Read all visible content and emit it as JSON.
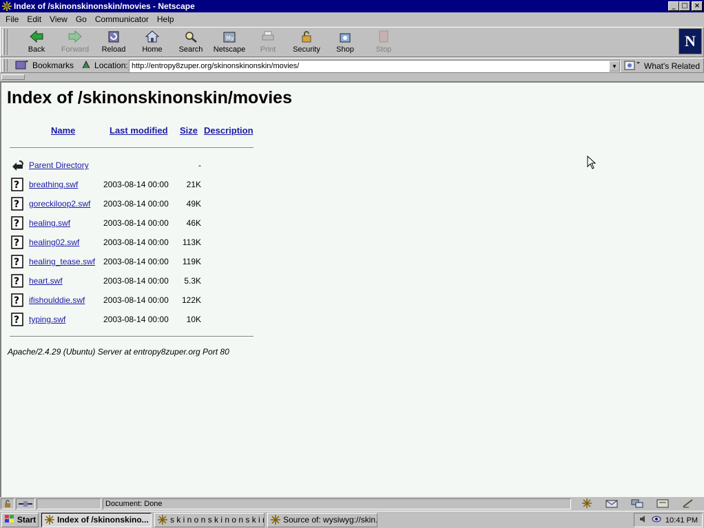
{
  "window": {
    "title": "Index of /skinonskinonskin/movies - Netscape",
    "controls": [
      "_",
      "□",
      "×"
    ]
  },
  "menubar": {
    "items": [
      {
        "label": "File"
      },
      {
        "label": "Edit"
      },
      {
        "label": "View"
      },
      {
        "label": "Go"
      },
      {
        "label": "Communicator"
      },
      {
        "label": "Help"
      }
    ]
  },
  "toolbar": {
    "buttons": [
      {
        "label": "Back",
        "icon": "back-arrow-icon",
        "enabled": true
      },
      {
        "label": "Forward",
        "icon": "forward-arrow-icon",
        "enabled": false
      },
      {
        "label": "Reload",
        "icon": "reload-icon",
        "enabled": true
      },
      {
        "label": "Home",
        "icon": "home-icon",
        "enabled": true
      },
      {
        "label": "Search",
        "icon": "search-icon",
        "enabled": true
      },
      {
        "label": "Netscape",
        "icon": "netscape-icon",
        "enabled": true
      },
      {
        "label": "Print",
        "icon": "printer-icon",
        "enabled": false
      },
      {
        "label": "Security",
        "icon": "lock-icon",
        "enabled": true
      },
      {
        "label": "Shop",
        "icon": "shop-icon",
        "enabled": true
      },
      {
        "label": "Stop",
        "icon": "stop-icon",
        "enabled": false
      }
    ],
    "logo_letter": "N"
  },
  "location_bar": {
    "bookmarks_label": "Bookmarks",
    "location_label": "Location:",
    "url": "http://entropy8zuper.org/skinonskinonskin/movies/",
    "whats_related_label": "What's Related"
  },
  "page": {
    "title": "Index of /skinonskinonskin/movies",
    "columns": {
      "name": "Name",
      "last_modified": "Last modified",
      "size": "Size",
      "description": "Description"
    },
    "parent": {
      "label": "Parent Directory",
      "size": "-"
    },
    "files": [
      {
        "name": "breathing.swf",
        "modified": "2003-08-14 00:00",
        "size": "21K"
      },
      {
        "name": "goreckiloop2.swf",
        "modified": "2003-08-14 00:00",
        "size": "49K"
      },
      {
        "name": "healing.swf",
        "modified": "2003-08-14 00:00",
        "size": "46K"
      },
      {
        "name": "healing02.swf",
        "modified": "2003-08-14 00:00",
        "size": "113K"
      },
      {
        "name": "healing_tease.swf",
        "modified": "2003-08-14 00:00",
        "size": "119K"
      },
      {
        "name": "heart.swf",
        "modified": "2003-08-14 00:00",
        "size": "5.3K"
      },
      {
        "name": "ifishoulddie.swf",
        "modified": "2003-08-14 00:00",
        "size": "122K"
      },
      {
        "name": "typing.swf",
        "modified": "2003-08-14 00:00",
        "size": "10K"
      }
    ],
    "server_signature": "Apache/2.4.29 (Ubuntu) Server at entropy8zuper.org Port 80"
  },
  "statusbar": {
    "text": "Document: Done"
  },
  "taskbar": {
    "start_label": "Start",
    "tasks": [
      {
        "label": "Index of /skinonskino...",
        "active": true
      },
      {
        "label": "s k i n o n s k i n o n s k i n...",
        "active": false
      },
      {
        "label": "Source of: wysiwyg://skin...",
        "active": false
      }
    ],
    "clock": "10:41 PM"
  },
  "colors": {
    "titlebar": "#000080",
    "link": "#1a1aa6",
    "page_background": "#f4f8f4",
    "chrome": "#c0c0c0"
  }
}
